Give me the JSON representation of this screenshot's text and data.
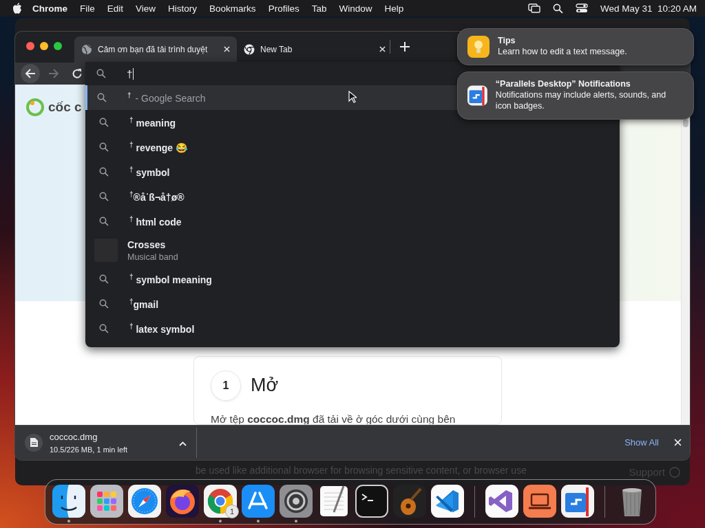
{
  "menu_bar": {
    "app": "Chrome",
    "items": [
      "File",
      "Edit",
      "View",
      "History",
      "Bookmarks",
      "Profiles",
      "Tab",
      "Window",
      "Help"
    ],
    "clock": "Wed May 31  10:20 AM"
  },
  "background_window": {
    "text": "be used like additional browser for browsing sensitive content, or browser use",
    "support": "Support"
  },
  "browser": {
    "tabs": [
      {
        "title": "Cảm ơn bạn đã tải trình duyệt",
        "selected": true
      },
      {
        "title": "New Tab",
        "selected": false
      }
    ],
    "nav": {
      "back_disabled": false,
      "forward_disabled": true
    },
    "address": {
      "value": "†"
    },
    "page": {
      "logo": "cốc c",
      "step_number": "1",
      "step_title": "Mở",
      "step_text": "Mở tệp **coccoc.dmg** đã tải về ở góc dưới cùng bên"
    },
    "download": {
      "file": "coccoc.dmg",
      "status": "10.5/226 MB, 1 min left",
      "show_all": "Show All"
    }
  },
  "suggestions": [
    {
      "kind": "search",
      "selected": true,
      "text": "$^{†}$",
      "suffix": "- Google Search"
    },
    {
      "kind": "search",
      "selected": false,
      "text": "$^{†}$ **meaning**"
    },
    {
      "kind": "search",
      "selected": false,
      "text": "$^{†}$ **revenge 😂**"
    },
    {
      "kind": "search",
      "selected": false,
      "text": "$^{†}$ **symbol**"
    },
    {
      "kind": "search",
      "selected": false,
      "text": "$^{†}$**®å˙ß¬å†ø®**"
    },
    {
      "kind": "search",
      "selected": false,
      "text": "$^{†}$ **html code**"
    },
    {
      "kind": "entity",
      "selected": false,
      "text": "Crosses",
      "subtitle": "Musical band"
    },
    {
      "kind": "search",
      "selected": false,
      "text": "$^{†}$ **symbol meaning**"
    },
    {
      "kind": "search",
      "selected": false,
      "text": "$^{†}$**gmail**"
    },
    {
      "kind": "search",
      "selected": false,
      "text": "$^{†}$ **latex symbol**"
    }
  ],
  "notifications": [
    {
      "title": "Tips",
      "body": "Learn how to edit a text message."
    },
    {
      "title": "“Parallels Desktop” Notifications",
      "body": "Notifications may include alerts, sounds, and icon badges."
    }
  ],
  "dock": [
    {
      "kind": "app",
      "running": true
    },
    {
      "kind": "app",
      "running": false
    },
    {
      "kind": "app",
      "running": false
    },
    {
      "kind": "app",
      "running": false
    },
    {
      "kind": "app",
      "running": true,
      "badge": "1"
    },
    {
      "kind": "app",
      "running": true
    },
    {
      "kind": "app",
      "running": true
    },
    {
      "kind": "app",
      "running": false
    },
    {
      "kind": "app",
      "running": false
    },
    {
      "kind": "app",
      "running": false
    },
    {
      "kind": "app",
      "running": false
    },
    {
      "kind": "divider"
    },
    {
      "kind": "app",
      "running": false
    },
    {
      "kind": "app",
      "running": false
    },
    {
      "kind": "app",
      "running": false
    },
    {
      "kind": "divider"
    },
    {
      "kind": "app",
      "running": false
    }
  ]
}
